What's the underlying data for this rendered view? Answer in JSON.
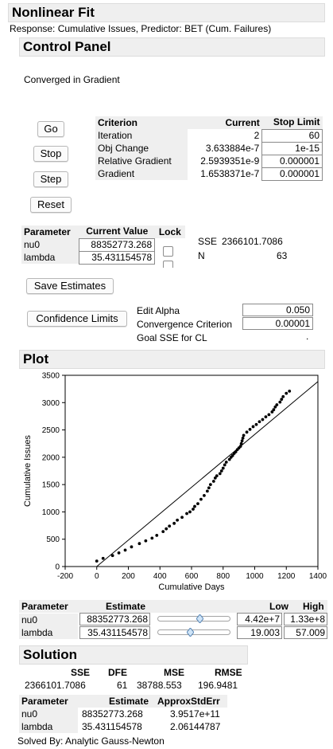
{
  "header": {
    "title": "Nonlinear Fit",
    "response_line": "Response: Cumulative Issues, Predictor: BET (Cum. Failures)"
  },
  "control_panel": {
    "title": "Control Panel",
    "status": "Converged in Gradient",
    "buttons": {
      "go": "Go",
      "stop": "Stop",
      "step": "Step",
      "reset": "Reset"
    },
    "criterion_table": {
      "headers": [
        "Criterion",
        "Current",
        "Stop Limit"
      ],
      "rows": [
        [
          "Iteration",
          "2",
          "60"
        ],
        [
          "Obj Change",
          "3.633884e-7",
          "1e-15"
        ],
        [
          "Relative Gradient",
          "2.5939351e-9",
          "0.000001"
        ],
        [
          "Gradient",
          "1.6538371e-7",
          "0.000001"
        ]
      ]
    },
    "param_table": {
      "headers": [
        "Parameter",
        "Current Value",
        "Lock"
      ],
      "rows": [
        [
          "nu0",
          "88352773.268"
        ],
        [
          "lambda",
          "35.431154578"
        ]
      ]
    },
    "sse_label": "SSE",
    "sse_value": "2366101.7086",
    "n_label": "N",
    "n_value": "63",
    "save_estimates": "Save Estimates",
    "confidence_limits": "Confidence Limits",
    "options": [
      {
        "label": "Edit Alpha",
        "value": "0.050"
      },
      {
        "label": "Convergence Criterion",
        "value": "0.00001"
      },
      {
        "label": "Goal SSE for CL",
        "value": "."
      }
    ]
  },
  "plot": {
    "title": "Plot"
  },
  "chart_data": {
    "type": "scatter",
    "xlabel": "Cumulative Days",
    "ylabel": "Cumulative Issues",
    "xlim": [
      -200,
      1400
    ],
    "ylim": [
      0,
      3500
    ],
    "xticks": [
      "-200",
      "0",
      "200",
      "400",
      "600",
      "800",
      "1000",
      "1200",
      "1400"
    ],
    "yticks": [
      "0",
      "500",
      "1000",
      "1500",
      "2000",
      "2500",
      "3000",
      "3500"
    ],
    "fit_line": {
      "x": [
        0,
        1400
      ],
      "y": [
        0,
        3385
      ]
    },
    "points": {
      "x": [
        0,
        40,
        100,
        140,
        180,
        220,
        270,
        310,
        350,
        380,
        420,
        440,
        460,
        490,
        510,
        540,
        570,
        590,
        610,
        620,
        640,
        660,
        680,
        700,
        710,
        720,
        740,
        750,
        760,
        780,
        790,
        800,
        810,
        820,
        840,
        850,
        860,
        870,
        880,
        890,
        900,
        910,
        915,
        920,
        925,
        930,
        950,
        970,
        990,
        1010,
        1030,
        1050,
        1070,
        1090,
        1110,
        1120,
        1130,
        1140,
        1160,
        1170,
        1180,
        1200,
        1220
      ],
      "y": [
        100,
        150,
        200,
        250,
        300,
        360,
        420,
        470,
        520,
        570,
        640,
        690,
        740,
        790,
        850,
        900,
        970,
        1000,
        1050,
        1100,
        1150,
        1230,
        1300,
        1380,
        1440,
        1500,
        1560,
        1620,
        1660,
        1700,
        1750,
        1800,
        1860,
        1910,
        1960,
        2000,
        2030,
        2070,
        2100,
        2140,
        2170,
        2200,
        2250,
        2300,
        2350,
        2400,
        2460,
        2510,
        2560,
        2600,
        2650,
        2690,
        2740,
        2780,
        2830,
        2870,
        2920,
        2960,
        3010,
        3060,
        3110,
        3170,
        3210
      ]
    }
  },
  "estimate_table": {
    "headers": [
      "Parameter",
      "Estimate",
      "Low",
      "High"
    ],
    "rows": [
      {
        "name": "nu0",
        "estimate": "88352773.268",
        "slider": 0.58,
        "low": "4.42e+7",
        "high": "1.33e+8"
      },
      {
        "name": "lambda",
        "estimate": "35.431154578",
        "slider": 0.45,
        "low": "19.003",
        "high": "57.009"
      }
    ]
  },
  "solution": {
    "title": "Solution",
    "summary_headers": [
      "SSE",
      "DFE",
      "MSE",
      "RMSE"
    ],
    "summary_values": [
      "2366101.7086",
      "61",
      "38788.553",
      "196.9481"
    ],
    "param_headers": [
      "Parameter",
      "Estimate",
      "ApproxStdErr"
    ],
    "param_rows": [
      [
        "nu0",
        "88352773.268",
        "3.9517e+11"
      ],
      [
        "lambda",
        "35.431154578",
        "2.06144787"
      ]
    ],
    "solved_by": "Solved By:  Analytic Gauss-Newton"
  }
}
